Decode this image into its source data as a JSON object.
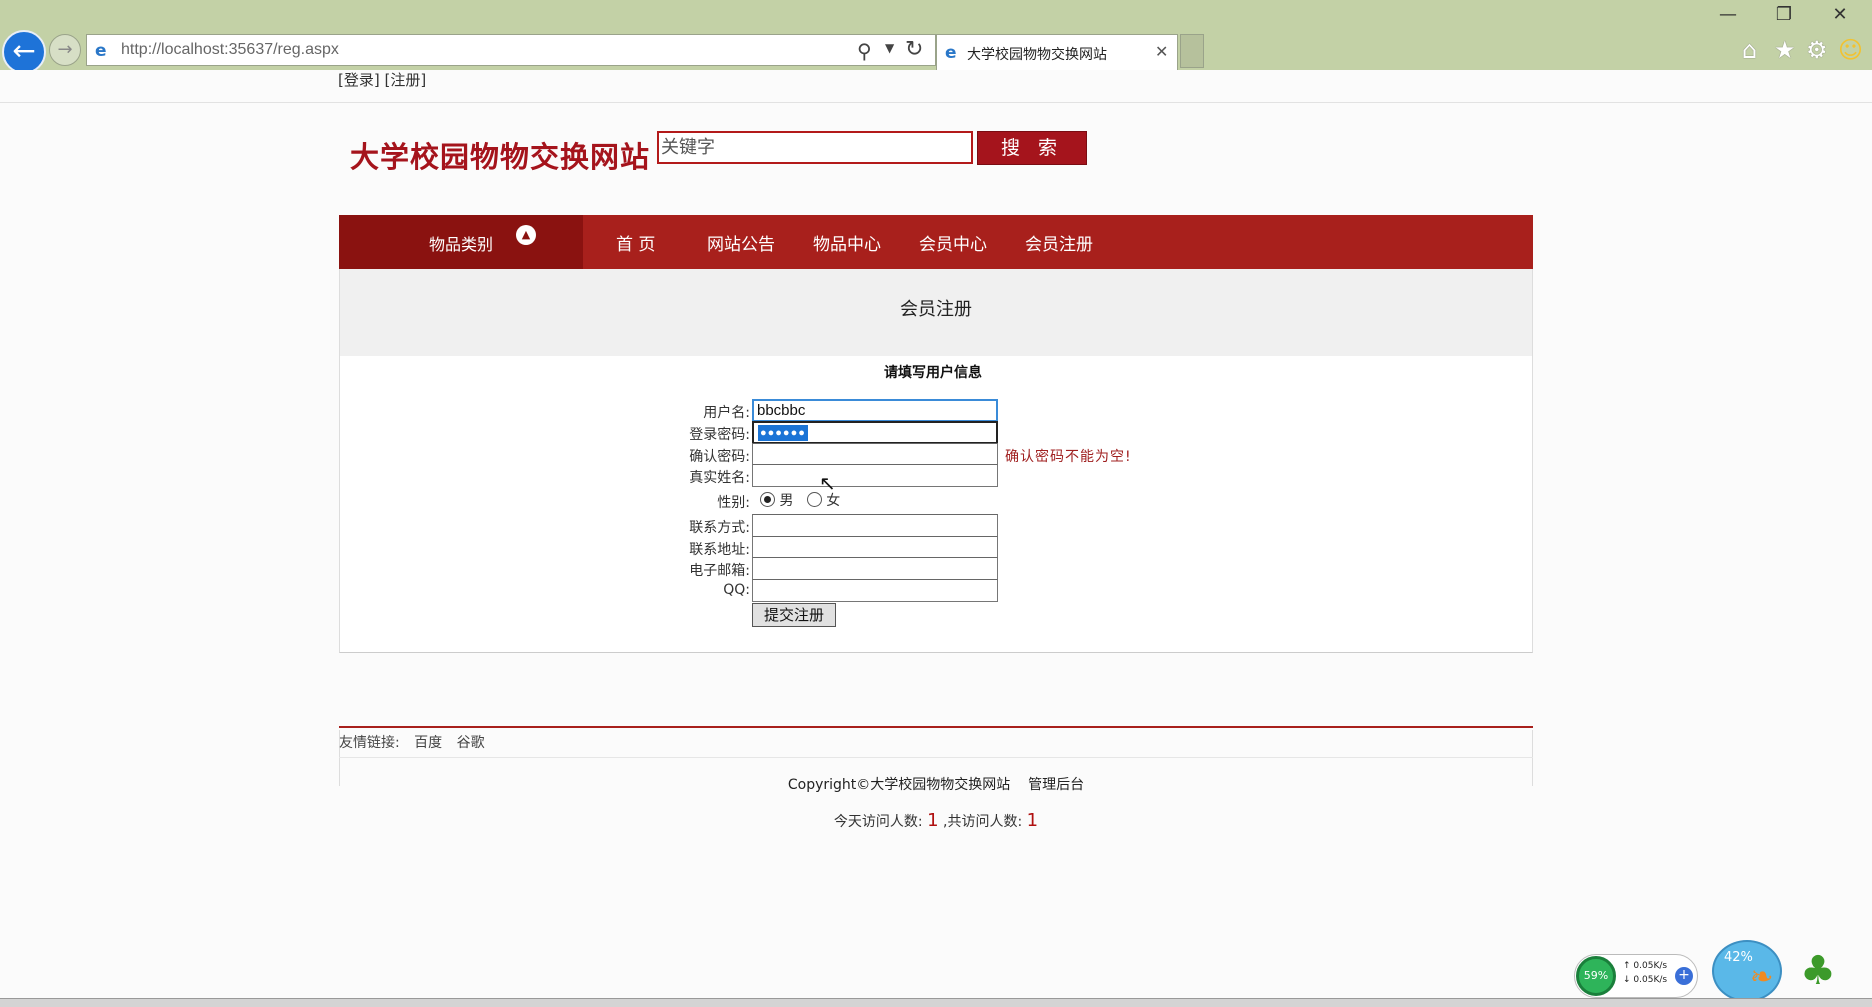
{
  "browser": {
    "url": "http://localhost:35637/reg.aspx",
    "tab_title": "大学校园物物交换网站",
    "window_controls": {
      "minimize": "—",
      "maximize": "❐",
      "close": "✕"
    },
    "icons": [
      "back-icon",
      "forward-icon",
      "ie-icon",
      "search-icon",
      "dropdown-icon",
      "refresh-icon",
      "close-icon",
      "home-icon",
      "star-icon",
      "gear-icon",
      "smiley-icon"
    ]
  },
  "top_links": {
    "login": "[登录]",
    "register": "[注册]"
  },
  "header": {
    "site_title": "大学校园物物交换网站",
    "search_placeholder": "关键字",
    "search_button": "搜 索"
  },
  "nav": {
    "category": "物品类别",
    "items": [
      "首 页",
      "网站公告",
      "物品中心",
      "会员中心",
      "会员注册"
    ]
  },
  "content": {
    "heading": "会员注册",
    "form_title": "请填写用户信息",
    "labels": {
      "username": "用户名:",
      "password": "登录密码:",
      "confirm": "确认密码:",
      "realname": "真实姓名:",
      "gender": "性别:",
      "contact": "联系方式:",
      "address": "联系地址:",
      "email": "电子邮箱:",
      "qq": "QQ:"
    },
    "values": {
      "username": "bbcbbc",
      "password_mask": "●●●●●●"
    },
    "gender_options": {
      "male": "男",
      "female": "女",
      "selected": "male"
    },
    "confirm_error": "确认密码不能为空!",
    "submit": "提交注册"
  },
  "footer": {
    "friend_label": "友情链接:",
    "friend_links": [
      "百度",
      "谷歌"
    ],
    "copyright": "Copyright©大学校园物物交换网站",
    "admin_link": "管理后台",
    "visits_today_label": "今天访问人数:",
    "visits_today": "1",
    "visits_total_label": ",共访问人数:",
    "visits_total": "1"
  },
  "widgets": {
    "speed_percent": "59%",
    "speed_up": "↑ 0.05K/s",
    "speed_down": "↓ 0.05K/s",
    "fish_percent": "42%"
  },
  "colors": {
    "brand": "#a5141c",
    "nav": "#a8201c",
    "nav_dark": "#8a1210",
    "error": "#a02020"
  }
}
